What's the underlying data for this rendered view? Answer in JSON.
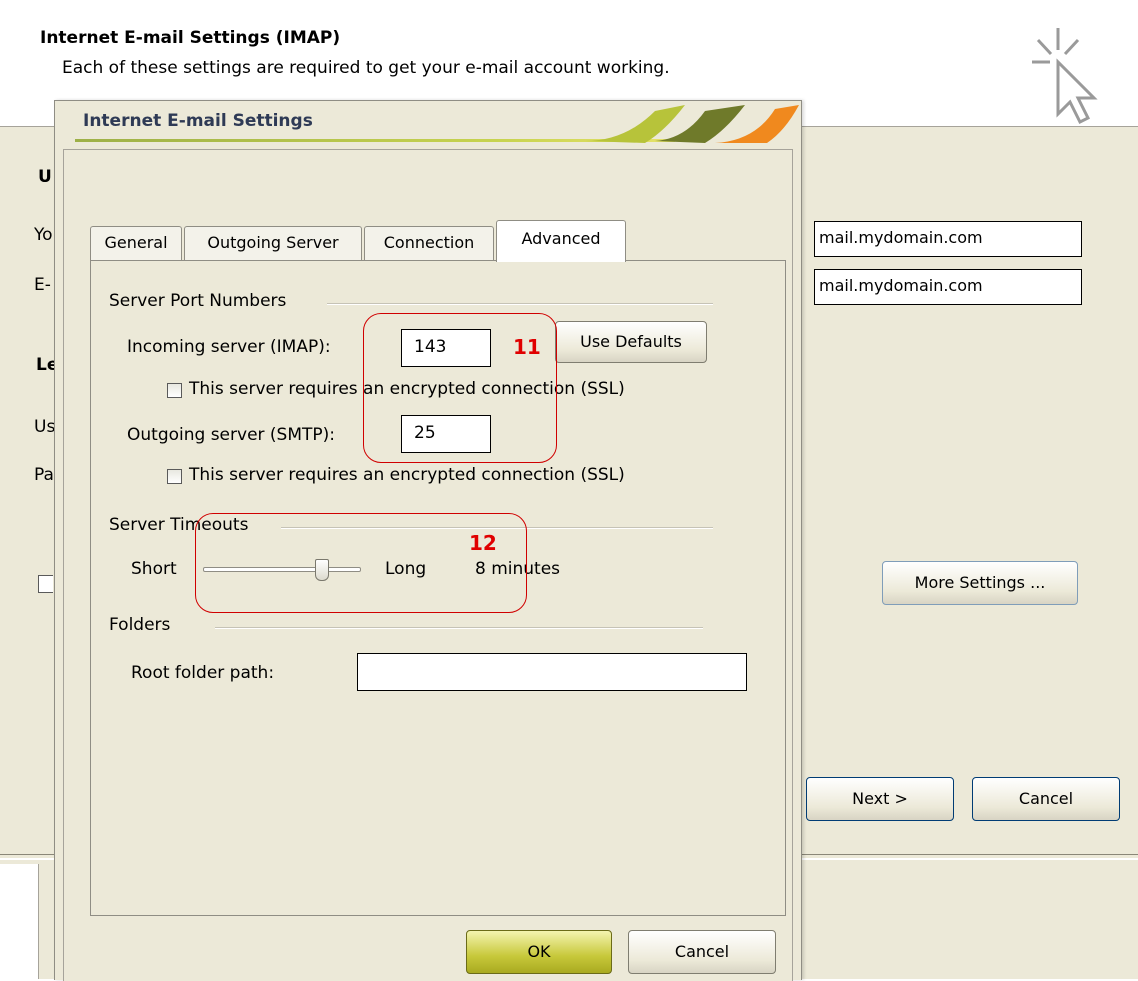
{
  "wizard": {
    "title": "Internet E-mail Settings (IMAP)",
    "subtitle": "Each of these settings are required to get your e-mail account working.",
    "partial_labels": [
      "U",
      "Yo",
      "E-",
      "Le",
      "Us",
      "Pa"
    ],
    "incoming_server_value": "mail.mydomain.com",
    "outgoing_server_value": "mail.mydomain.com",
    "more_settings_label": "More Settings ...",
    "next_label": "Next >",
    "cancel_label": "Cancel"
  },
  "dialog": {
    "title": "Internet E-mail Settings",
    "tabs": [
      {
        "label": "General",
        "active": false
      },
      {
        "label": "Outgoing Server",
        "active": false
      },
      {
        "label": "Connection",
        "active": false
      },
      {
        "label": "Advanced",
        "active": true
      }
    ],
    "server_ports": {
      "group_label": "Server Port Numbers",
      "incoming_label": "Incoming server (IMAP):",
      "incoming_value": "143",
      "use_defaults_label": "Use Defaults",
      "incoming_ssl_label": "This server requires an encrypted connection (SSL)",
      "incoming_ssl_checked": false,
      "outgoing_label": "Outgoing server (SMTP):",
      "outgoing_value": "25",
      "outgoing_ssl_label": "This server requires an encrypted connection (SSL)",
      "outgoing_ssl_checked": false
    },
    "timeouts": {
      "group_label": "Server Timeouts",
      "short_label": "Short",
      "long_label": "Long",
      "value_label": "8 minutes",
      "slider_level": 0.75
    },
    "folders": {
      "group_label": "Folders",
      "root_label": "Root folder path:",
      "root_value": ""
    },
    "ok_label": "OK",
    "cancel_label": "Cancel"
  },
  "annotations": {
    "ports_number": "11",
    "timeouts_number": "12",
    "color": "#d00000"
  }
}
